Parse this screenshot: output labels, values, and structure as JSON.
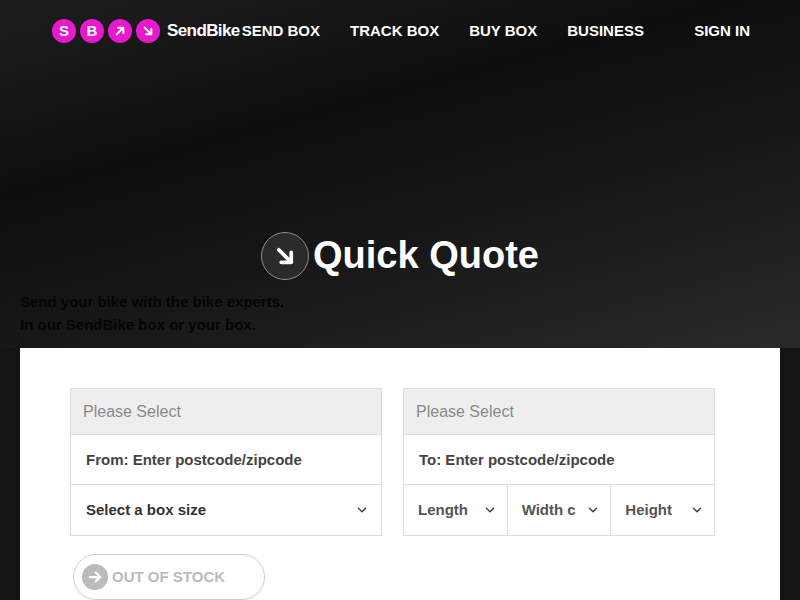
{
  "nav": {
    "logo": {
      "letters": [
        "S",
        "B"
      ],
      "name": "SendBike"
    },
    "links": [
      "SEND BOX",
      "TRACK BOX",
      "BUY BOX",
      "BUSINESS"
    ],
    "signin": "SIGN IN"
  },
  "hero": {
    "title": "Quick Quote",
    "lines": [
      "Send your bike with the bike experts.",
      "In our SendBike box or your box."
    ]
  },
  "quote": {
    "from": {
      "country": "Please Select",
      "postcode_placeholder": "From: Enter postcode/zipcode",
      "box_size": "Select a box size"
    },
    "to": {
      "country": "Please Select",
      "postcode_placeholder": "To: Enter postcode/zipcode",
      "dimensions": [
        "Length",
        "Width c",
        "Height"
      ]
    },
    "button": {
      "label": "OUT OF STOCK",
      "disabled": true
    }
  }
}
